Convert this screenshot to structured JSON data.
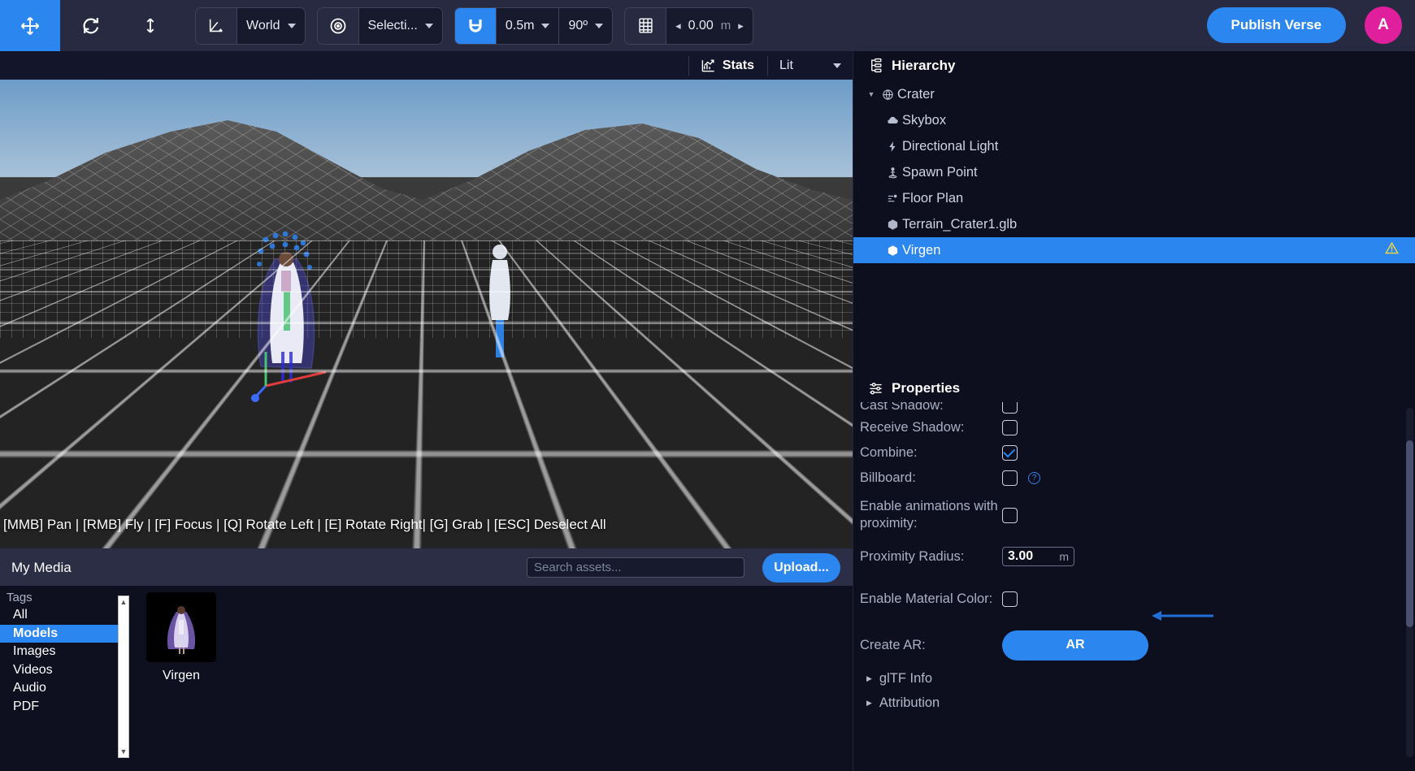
{
  "toolbar": {
    "tools": [
      {
        "name": "move-tool",
        "glyph": "✥",
        "active": true
      },
      {
        "name": "rotate-tool",
        "glyph": "⟳",
        "active": false
      },
      {
        "name": "scale-tool",
        "glyph": "↕",
        "active": false
      }
    ],
    "transform_space": {
      "icon": "axis-icon",
      "value": "World"
    },
    "pivot": {
      "icon": "target-icon",
      "value": "Selecti..."
    },
    "snap": {
      "icon": "magnet-icon",
      "grid_value": "0.5m",
      "angle_value": "90º",
      "enabled": true
    },
    "grid": {
      "icon": "grid-icon",
      "value": "0.00",
      "unit": "m",
      "prev": "◂",
      "next": "▸"
    },
    "publish_label": "Publish Verse",
    "avatar_initial": "A",
    "accent": "#2b86ef",
    "avatar_color": "#e01f9c"
  },
  "viewport": {
    "stats_label": "Stats",
    "shading_value": "Lit",
    "help_text": "[MMB] Pan | [RMB] Fly | [F] Focus | [Q] Rotate Left | [E] Rotate Right| [G] Grab | [ESC] Deselect All"
  },
  "media": {
    "title": "My Media",
    "search_placeholder": "Search assets...",
    "search_value": "",
    "upload_label": "Upload...",
    "tags_label": "Tags",
    "tags": [
      {
        "label": "All",
        "selected": false
      },
      {
        "label": "Models",
        "selected": true
      },
      {
        "label": "Images",
        "selected": false
      },
      {
        "label": "Videos",
        "selected": false
      },
      {
        "label": "Audio",
        "selected": false
      },
      {
        "label": "PDF",
        "selected": false
      }
    ],
    "assets": [
      {
        "label": "Virgen"
      }
    ]
  },
  "hierarchy": {
    "title": "Hierarchy",
    "items": [
      {
        "label": "Crater",
        "icon": "globe-icon",
        "depth": 0,
        "expandable": true,
        "selected": false,
        "warning": false
      },
      {
        "label": "Skybox",
        "icon": "cloud-icon",
        "depth": 1,
        "expandable": false,
        "selected": false,
        "warning": false
      },
      {
        "label": "Directional Light",
        "icon": "bolt-icon",
        "depth": 1,
        "expandable": false,
        "selected": false,
        "warning": false
      },
      {
        "label": "Spawn Point",
        "icon": "spawn-icon",
        "depth": 1,
        "expandable": false,
        "selected": false,
        "warning": false
      },
      {
        "label": "Floor Plan",
        "icon": "floorplan-icon",
        "depth": 1,
        "expandable": false,
        "selected": false,
        "warning": false
      },
      {
        "label": "Terrain_Crater1.glb",
        "icon": "cube-icon",
        "depth": 1,
        "expandable": false,
        "selected": false,
        "warning": false
      },
      {
        "label": "Virgen",
        "icon": "cube-icon",
        "depth": 1,
        "expandable": false,
        "selected": true,
        "warning": true
      }
    ]
  },
  "properties": {
    "title": "Properties",
    "rows": [
      {
        "type": "checkbox",
        "label": "Cast Shadow:",
        "checked": false,
        "help": false,
        "clipped": true
      },
      {
        "type": "checkbox",
        "label": "Receive Shadow:",
        "checked": false,
        "help": false
      },
      {
        "type": "checkbox",
        "label": "Combine:",
        "checked": true,
        "help": false
      },
      {
        "type": "checkbox",
        "label": "Billboard:",
        "checked": false,
        "help": true
      },
      {
        "type": "checkbox",
        "label": "Enable animations with proximity:",
        "checked": false,
        "help": false
      },
      {
        "type": "number",
        "label": "Proximity Radius:",
        "value": "3.00",
        "unit": "m"
      },
      {
        "type": "checkbox",
        "label": "Enable Material Color:",
        "checked": false,
        "help": false
      },
      {
        "type": "button",
        "label": "Create AR:",
        "button_label": "AR"
      }
    ],
    "collapsibles": [
      {
        "label": "glTF Info"
      },
      {
        "label": "Attribution"
      }
    ]
  }
}
